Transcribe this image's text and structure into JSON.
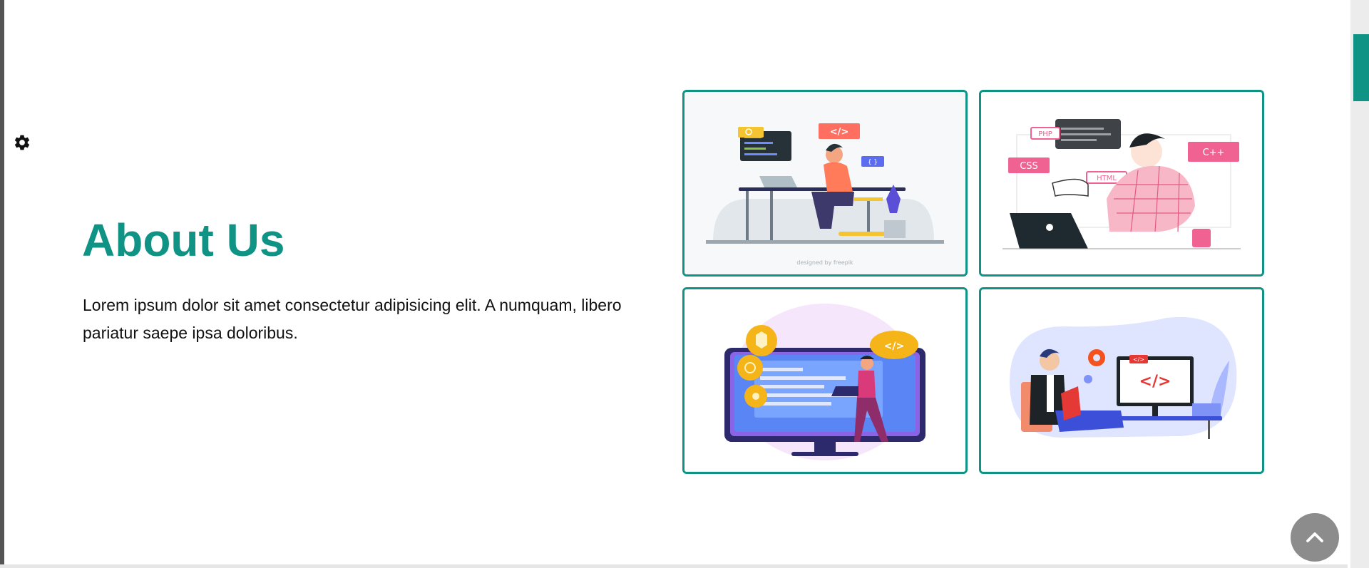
{
  "about": {
    "title": "About Us",
    "text": "Lorem ipsum dolor sit amet consectetur adipisicing elit. A numquam, libero pariatur saepe ipsa doloribus."
  },
  "gallery": [
    {
      "name": "developer-at-desk",
      "badges": [
        "</>",
        "{ }"
      ],
      "credit": "designed by freepik"
    },
    {
      "name": "developer-with-languages",
      "badges": [
        "PHP",
        "CSS",
        "C++",
        "HTML"
      ]
    },
    {
      "name": "developer-with-monitor",
      "badges": [
        "</>"
      ]
    },
    {
      "name": "developer-reading-book",
      "badges": [
        "</>",
        "</>"
      ]
    }
  ],
  "icons": {
    "settings": "gear-icon",
    "scroll_top": "chevron-up-icon"
  },
  "colors": {
    "accent": "#0e9384",
    "text": "#111111",
    "scroll_top_button": "#8c8c8c"
  }
}
